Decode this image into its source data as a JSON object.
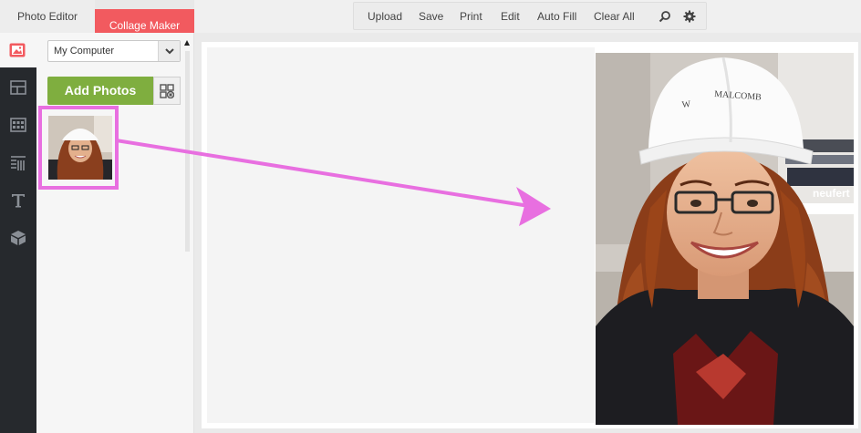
{
  "tabs": [
    {
      "label": "Photo Editor",
      "active": false
    },
    {
      "label": "Collage Maker",
      "active": true
    }
  ],
  "toolbar": {
    "upload": "Upload",
    "save": "Save",
    "print": "Print",
    "edit": "Edit",
    "auto_fill": "Auto Fill",
    "clear_all": "Clear All",
    "icons": [
      "search-icon",
      "gear-icon"
    ]
  },
  "rail": {
    "items": [
      "image-icon",
      "layout-icon",
      "grid-icon",
      "pattern-icon",
      "text-icon",
      "sticker-box-icon"
    ]
  },
  "panel": {
    "source": "My Computer",
    "add_photos": "Add Photos"
  },
  "hardhat": {
    "text": "MALCOMB",
    "prefix": "W"
  },
  "book_label": "neufert",
  "colors": {
    "accent_red": "#f25a5f",
    "add_green": "#7fae3f",
    "highlight_magenta": "#e86fe0",
    "rail_dark": "#26292d"
  }
}
